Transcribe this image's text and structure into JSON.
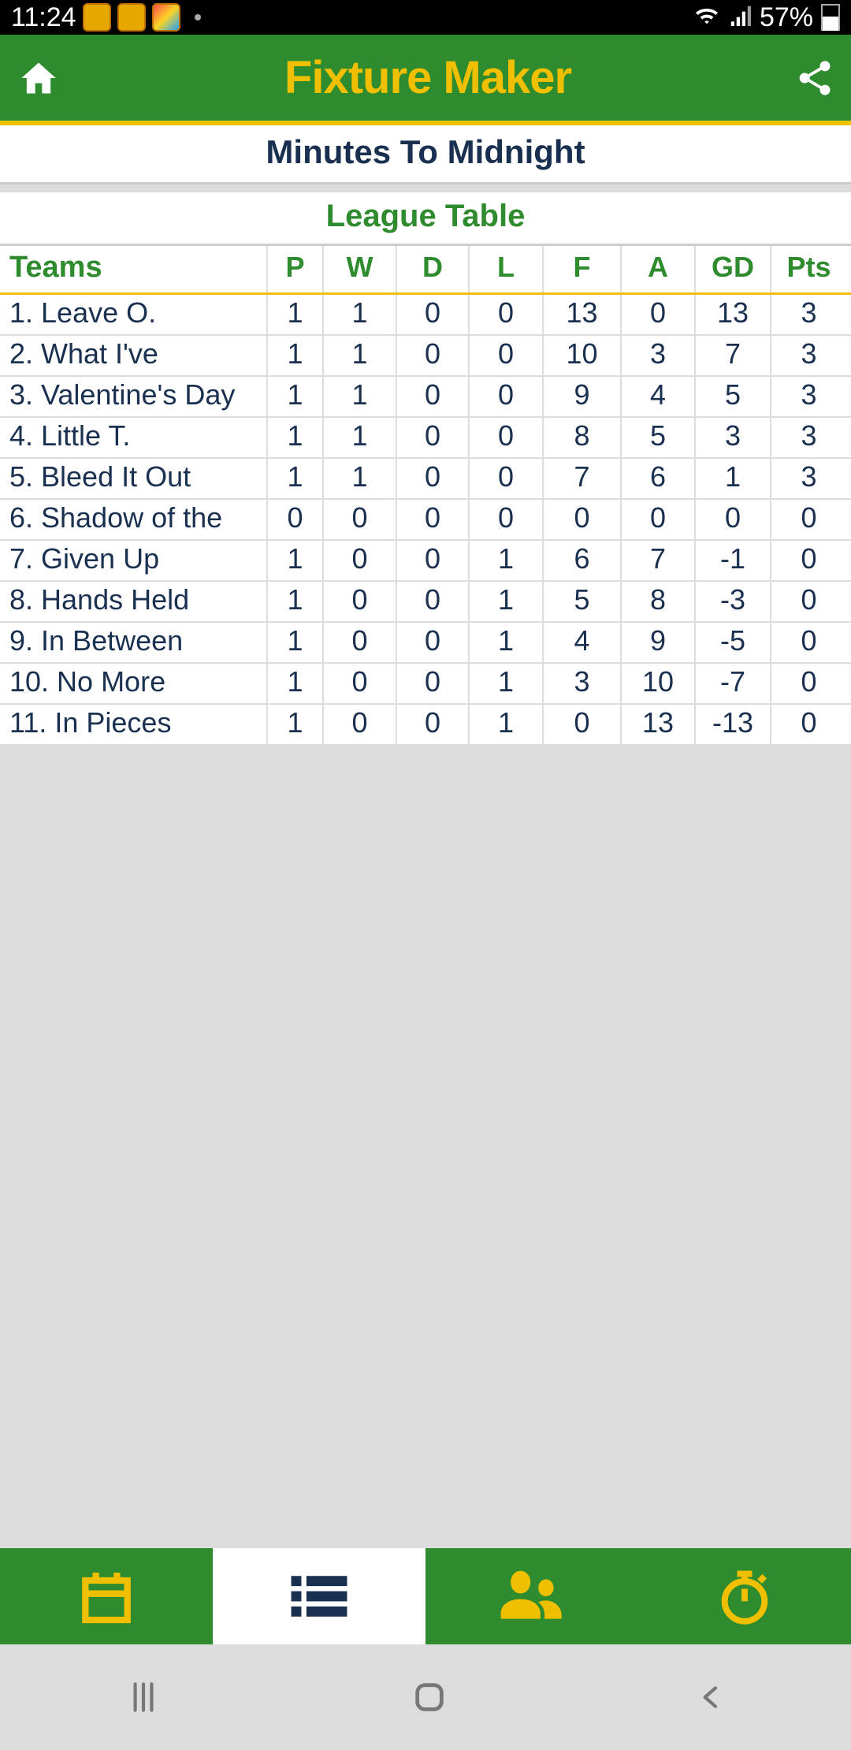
{
  "status": {
    "time": "11:24",
    "battery": "57%"
  },
  "header": {
    "title": "Fixture Maker"
  },
  "subtitle1": "Minutes To Midnight",
  "subtitle2": "League Table",
  "columns": {
    "teams": "Teams",
    "p": "P",
    "w": "W",
    "d": "D",
    "l": "L",
    "f": "F",
    "a": "A",
    "gd": "GD",
    "pts": "Pts"
  },
  "rows": [
    {
      "team": "1. Leave O.",
      "p": "1",
      "w": "1",
      "d": "0",
      "l": "0",
      "f": "13",
      "a": "0",
      "gd": "13",
      "pts": "3"
    },
    {
      "team": "2. What I've",
      "p": "1",
      "w": "1",
      "d": "0",
      "l": "0",
      "f": "10",
      "a": "3",
      "gd": "7",
      "pts": "3"
    },
    {
      "team": "3. Valentine's Day",
      "p": "1",
      "w": "1",
      "d": "0",
      "l": "0",
      "f": "9",
      "a": "4",
      "gd": "5",
      "pts": "3"
    },
    {
      "team": "4. Little T.",
      "p": "1",
      "w": "1",
      "d": "0",
      "l": "0",
      "f": "8",
      "a": "5",
      "gd": "3",
      "pts": "3"
    },
    {
      "team": "5. Bleed It Out",
      "p": "1",
      "w": "1",
      "d": "0",
      "l": "0",
      "f": "7",
      "a": "6",
      "gd": "1",
      "pts": "3"
    },
    {
      "team": "6. Shadow of the",
      "p": "0",
      "w": "0",
      "d": "0",
      "l": "0",
      "f": "0",
      "a": "0",
      "gd": "0",
      "pts": "0"
    },
    {
      "team": "7. Given Up",
      "p": "1",
      "w": "0",
      "d": "0",
      "l": "1",
      "f": "6",
      "a": "7",
      "gd": "-1",
      "pts": "0"
    },
    {
      "team": "8. Hands Held",
      "p": "1",
      "w": "0",
      "d": "0",
      "l": "1",
      "f": "5",
      "a": "8",
      "gd": "-3",
      "pts": "0"
    },
    {
      "team": "9. In Between",
      "p": "1",
      "w": "0",
      "d": "0",
      "l": "1",
      "f": "4",
      "a": "9",
      "gd": "-5",
      "pts": "0"
    },
    {
      "team": "10. No More",
      "p": "1",
      "w": "0",
      "d": "0",
      "l": "1",
      "f": "3",
      "a": "10",
      "gd": "-7",
      "pts": "0"
    },
    {
      "team": "11. In Pieces",
      "p": "1",
      "w": "0",
      "d": "0",
      "l": "1",
      "f": "0",
      "a": "13",
      "gd": "-13",
      "pts": "0"
    }
  ]
}
